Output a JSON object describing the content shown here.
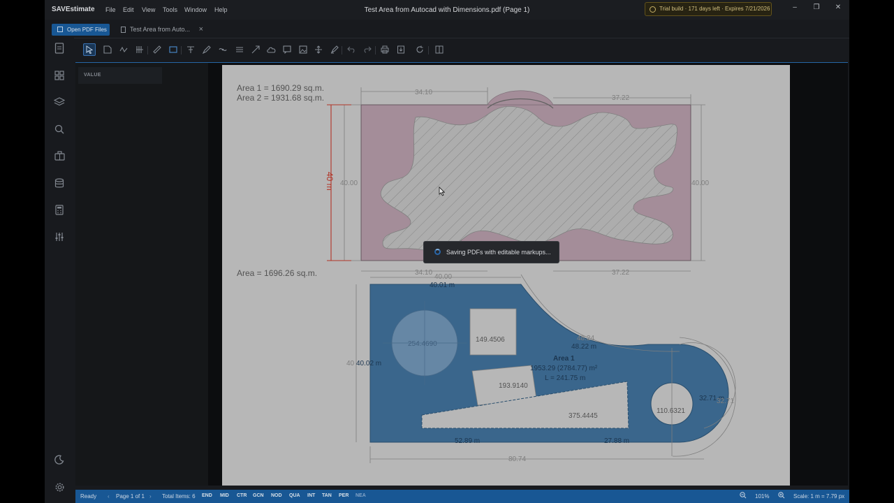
{
  "app": {
    "brand": "SAVEstimate",
    "menu": [
      "File",
      "Edit",
      "View",
      "Tools",
      "Window",
      "Help"
    ],
    "window_title": "Test Area from Autocad with Dimensions.pdf (Page 1)",
    "trial_badge": "Trial build · 171 days left · Expires 7/21/2026"
  },
  "tabs": {
    "open_button": "Open PDF Files",
    "document_tab": "Test Area from Auto...",
    "close_glyph": "×"
  },
  "panel": {
    "header": "VALUE"
  },
  "drawing": {
    "area_note_1": "Area 1 = 1690.29 sq.m.",
    "area_note_2": "Area 2 = 1931.68 sq.m.",
    "area_note_3": "Area = 1696.26 sq.m.",
    "dim_top_left": "34.10",
    "dim_top_right": "37.22",
    "dim_left": "40.00",
    "dim_right": "40.00",
    "dim_red": "40 m",
    "dim_bottom_left": "34.10",
    "dim_bottom_right": "37.22",
    "dim_lower_top_gray": "40.00",
    "dim_lower_top": "40.01 m",
    "dim_lower_left_gray": "40",
    "dim_lower_left": "40.02 m",
    "dim_arc_gray": "48.24",
    "dim_arc": "48.22 m",
    "area1_label": "Area 1",
    "area1_value": "1953.29 (2784.77) m²",
    "area1_length": "L = 241.75 m",
    "circle_value": "254.4690",
    "square_value": "149.4506",
    "rect_value": "193.9140",
    "wedge_value": "375.4445",
    "small_circle_value": "110.6321",
    "dim_circle_right": "32.71 m",
    "dim_circle_right_gray": "32.71",
    "dim_bottom_a": "52.89 m",
    "dim_bottom_b": "27.88 m",
    "dim_total": "80.74"
  },
  "toast": {
    "message": "Saving PDFs with editable markups..."
  },
  "status": {
    "ready": "Ready",
    "page": "Page 1 of 1",
    "total": "Total Items: 6",
    "snaps": [
      "END",
      "MID",
      "CTR",
      "GCN",
      "NOD",
      "QUA",
      "INT",
      "TAN",
      "PER",
      "NEA"
    ],
    "zoom": "101%",
    "scale": "Scale: 1 m = 7.79 px"
  },
  "colors": {
    "accent": "#1b5fa1",
    "dimension_red": "#c0392b",
    "fill_purple": "#b29aa6",
    "fill_blue": "#3f6f98"
  }
}
